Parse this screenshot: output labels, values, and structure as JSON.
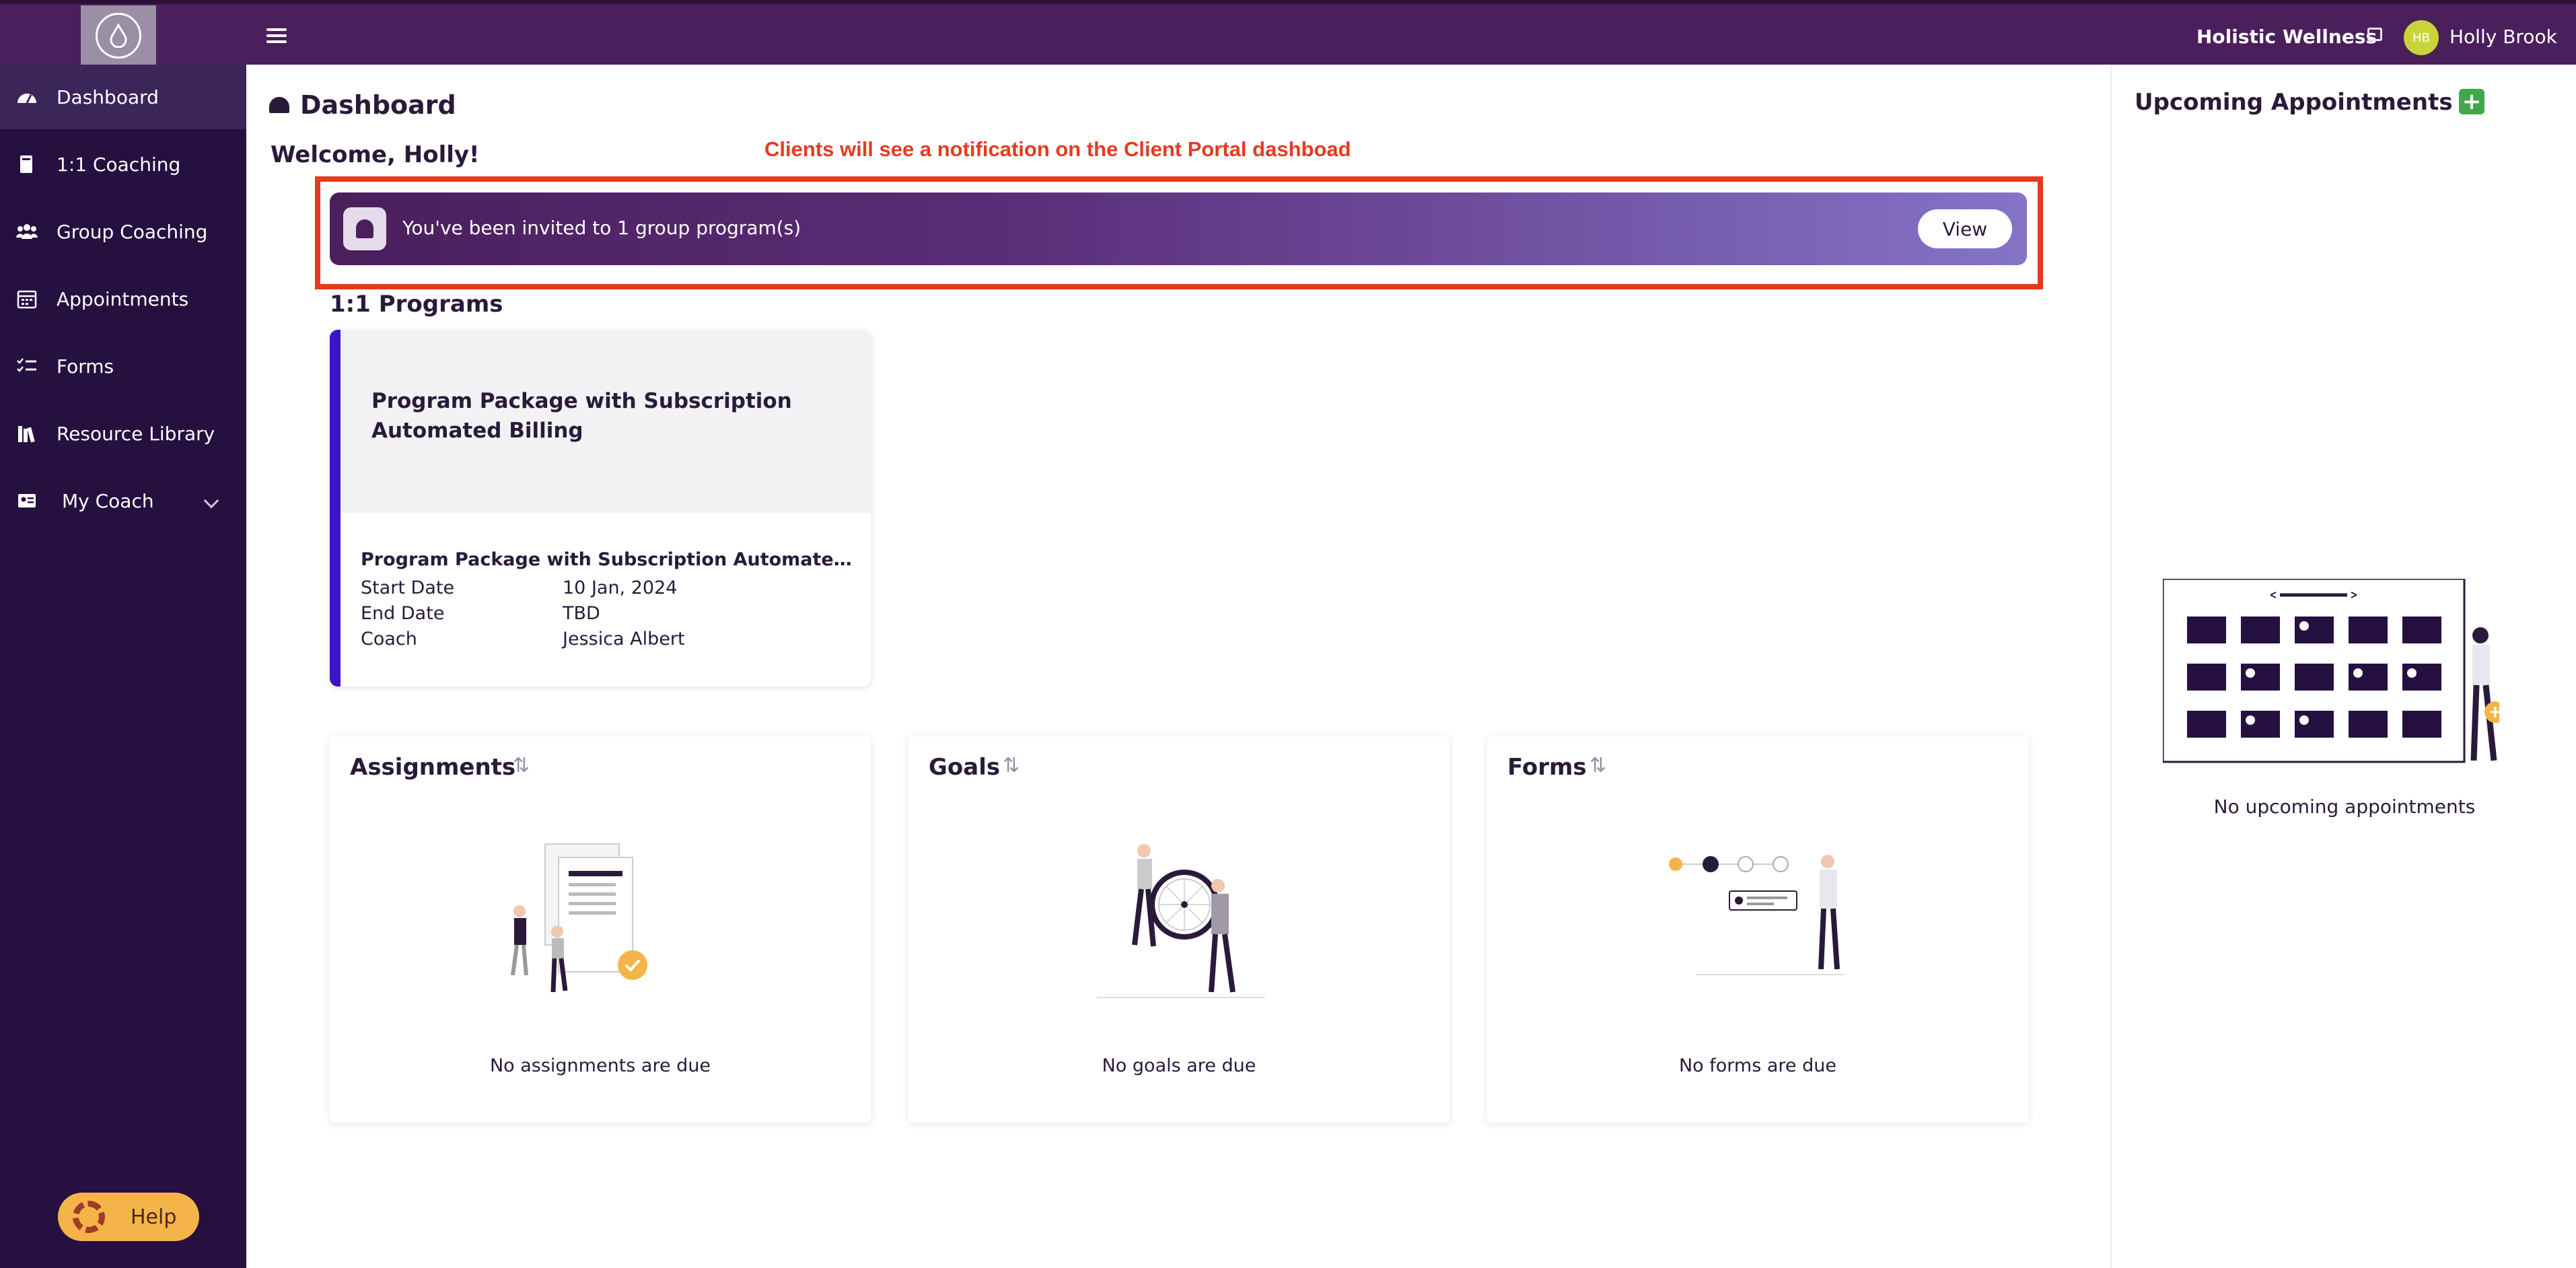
{
  "topbar": {
    "brand": "Holistic Wellness",
    "avatar_initials": "HB",
    "username": "Holly Brook"
  },
  "sidebar": {
    "items": [
      {
        "label": "Dashboard",
        "icon": "gauge-icon",
        "active": true
      },
      {
        "label": "1:1 Coaching",
        "icon": "book-icon"
      },
      {
        "label": "Group Coaching",
        "icon": "users-icon"
      },
      {
        "label": "Appointments",
        "icon": "calendar-icon"
      },
      {
        "label": "Forms",
        "icon": "checklist-icon"
      },
      {
        "label": "Resource Library",
        "icon": "books-icon"
      },
      {
        "label": "My Coach",
        "icon": "coach-card-icon"
      }
    ],
    "help_label": "Help"
  },
  "main": {
    "title": "Dashboard",
    "welcome": "Welcome, Holly!",
    "annotation": "Clients will see a notification on the Client Portal dashboad",
    "banner": {
      "text": "You've been invited to 1 group program(s)",
      "button": "View"
    },
    "programs_title": "1:1 Programs",
    "program_card": {
      "header_title": "Program Package with Subscription Automated Billing",
      "subtitle": "Program Package with Subscription Automated Billing",
      "rows": [
        {
          "label": "Start Date",
          "value": "10 Jan, 2024"
        },
        {
          "label": "End Date",
          "value": "TBD"
        },
        {
          "label": "Coach",
          "value": "Jessica Albert"
        }
      ]
    },
    "widgets": [
      {
        "title": "Assignments",
        "empty": "No assignments are due"
      },
      {
        "title": "Goals",
        "empty": "No goals are due"
      },
      {
        "title": "Forms",
        "empty": "No forms are due"
      }
    ]
  },
  "right_panel": {
    "title": "Upcoming Appointments",
    "empty": "No upcoming appointments"
  },
  "colors": {
    "topbar": "#4a1f5c",
    "sidebar": "#261040",
    "accent_red": "#e43b1f",
    "program_accent": "#3a14c8",
    "help": "#f5b44a",
    "add_green": "#3fa84a"
  }
}
